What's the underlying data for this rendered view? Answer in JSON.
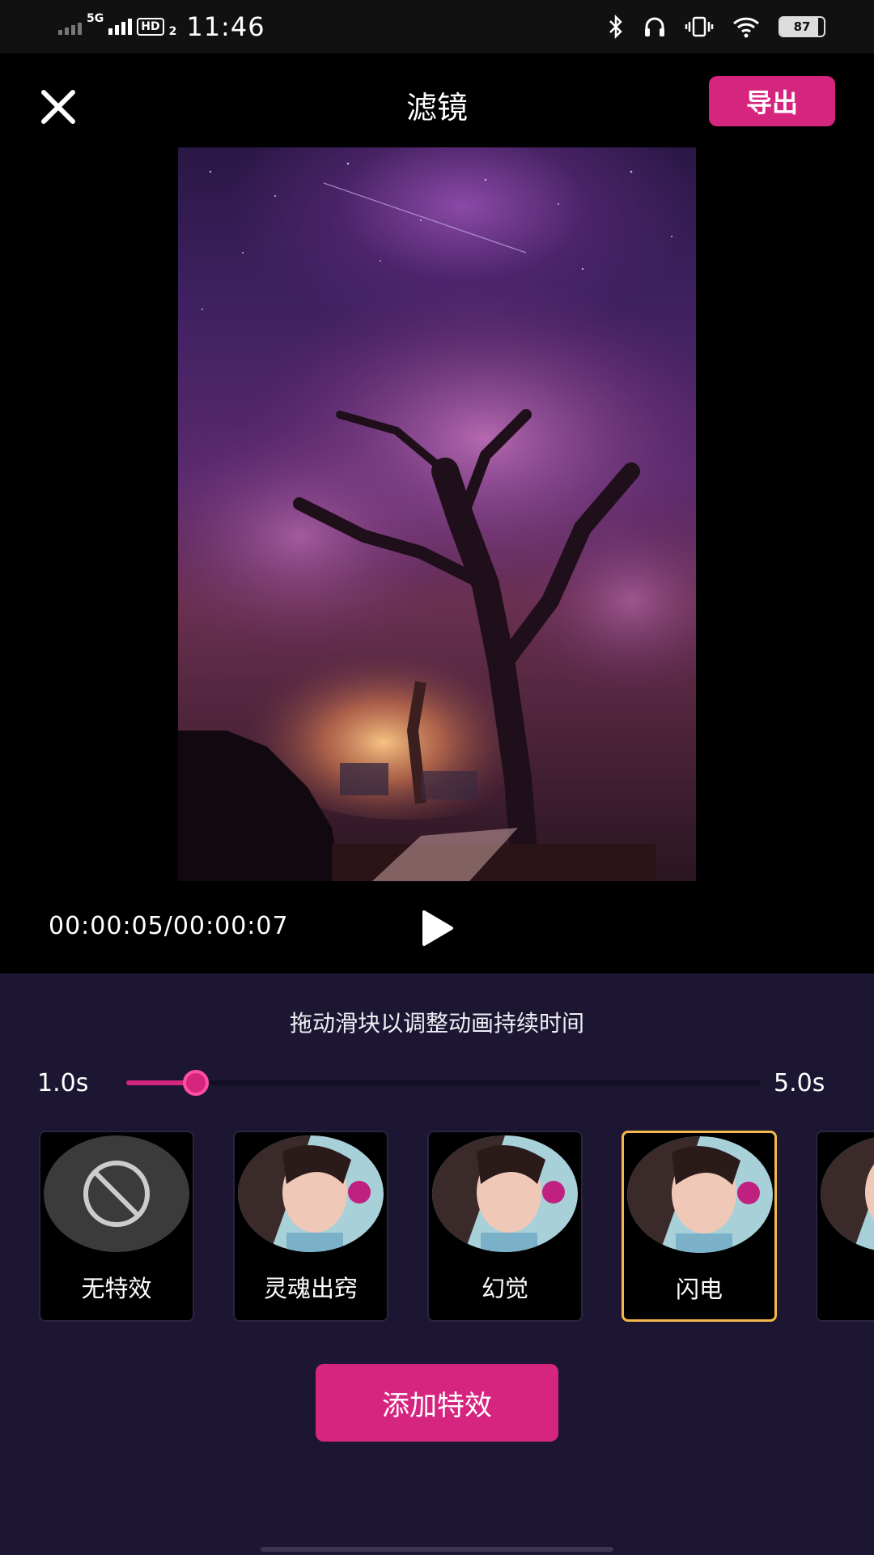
{
  "status_bar": {
    "network": "5G",
    "hd": "HD",
    "sim": "2",
    "time": "11:46",
    "battery": "87",
    "icons": [
      "bluetooth-icon",
      "headphones-icon",
      "vibrate-icon",
      "wifi-icon",
      "battery-icon"
    ]
  },
  "header": {
    "close_icon": "close-icon",
    "title": "滤镜",
    "export_label": "导出"
  },
  "player": {
    "time_display": "00:00:05/00:00:07",
    "play_icon": "play-icon"
  },
  "duration": {
    "hint": "拖动滑块以调整动画持续时间",
    "min_label": "1.0s",
    "max_label": "5.0s",
    "value_fraction": 0.11
  },
  "effects": [
    {
      "label": "无特效",
      "icon": "no-effect-icon",
      "selected": false
    },
    {
      "label": "灵魂出窍",
      "selected": false
    },
    {
      "label": "幻觉",
      "selected": false
    },
    {
      "label": "闪电",
      "selected": true
    },
    {
      "label": "",
      "selected": false
    }
  ],
  "add_button_label": "添加特效",
  "colors": {
    "accent": "#d6257f",
    "panel": "#1c1633",
    "selected_border": "#f5b84a"
  }
}
